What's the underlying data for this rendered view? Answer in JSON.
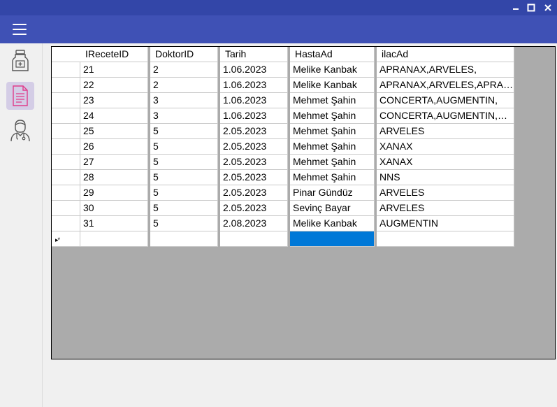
{
  "colors": {
    "title_bar": "#3346a8",
    "app_bar": "#3f51b5",
    "grid_background": "#ababab",
    "selected_cell": "#0078d7",
    "active_nav": "#d4cde6"
  },
  "window": {
    "controls": [
      "minimize-icon",
      "maximize-icon",
      "close-icon"
    ]
  },
  "sidebar": {
    "items": [
      {
        "name": "medicine-bottle-icon",
        "active": false
      },
      {
        "name": "prescription-document-icon",
        "active": true
      },
      {
        "name": "doctor-icon",
        "active": false
      }
    ]
  },
  "grid": {
    "columns": [
      "IReceteID",
      "DoktorID",
      "Tarih",
      "HastaAd",
      "ilacAd"
    ],
    "rows": [
      [
        "21",
        "2",
        "1.06.2023",
        "Melike Kanbak",
        "APRANAX,ARVELES,"
      ],
      [
        "22",
        "2",
        "1.06.2023",
        "Melike Kanbak",
        "APRANAX,ARVELES,APRAN..."
      ],
      [
        "23",
        "3",
        "1.06.2023",
        "Mehmet Şahin",
        "CONCERTA,AUGMENTIN,"
      ],
      [
        "24",
        "3",
        "1.06.2023",
        "Mehmet Şahin",
        "CONCERTA,AUGMENTIN,CO..."
      ],
      [
        "25",
        "5",
        "2.05.2023",
        "Mehmet Şahin",
        "ARVELES"
      ],
      [
        "26",
        "5",
        "2.05.2023",
        "Mehmet Şahin",
        "XANAX"
      ],
      [
        "27",
        "5",
        "2.05.2023",
        "Mehmet Şahin",
        "XANAX"
      ],
      [
        "28",
        "5",
        "2.05.2023",
        "Mehmet Şahin",
        "NNS"
      ],
      [
        "29",
        "5",
        "2.05.2023",
        "Pinar Gündüz",
        "ARVELES"
      ],
      [
        "30",
        "5",
        "2.05.2023",
        "Sevinç Bayar",
        "ARVELES"
      ],
      [
        "31",
        "5",
        "2.08.2023",
        "Melike Kanbak",
        "AUGMENTIN"
      ]
    ],
    "new_row_marker": "▸*",
    "selected_cell": {
      "row": "new",
      "column": "HastaAd"
    }
  }
}
